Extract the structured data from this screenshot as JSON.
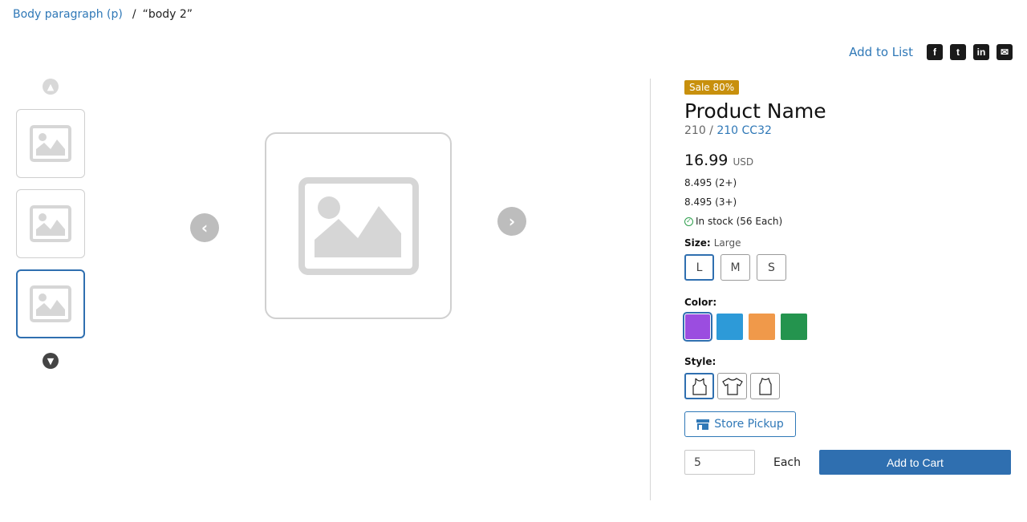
{
  "breadcrumb": {
    "link": "Body paragraph (p)",
    "separator": "/",
    "current": "“body 2”"
  },
  "share": {
    "add_to_list": "Add to List",
    "icons": [
      "facebook-icon",
      "twitter-icon",
      "linkedin-icon",
      "email-icon"
    ],
    "facebook_glyph": "f",
    "twitter_glyph": "t",
    "linkedin_glyph": "in",
    "email_glyph": "✉"
  },
  "gallery": {
    "thumbnails": [
      "image-placeholder",
      "image-placeholder",
      "image-placeholder"
    ],
    "active_thumbnail": 3,
    "prev_glyph": "‹",
    "next_glyph": "›",
    "up_glyph": "▲",
    "down_glyph": "▼"
  },
  "product": {
    "badge": "Sale 80%",
    "name": "Product Name",
    "sku_prefix": "210 / ",
    "sku_link": "210 CC32",
    "price": "16.99",
    "currency": "USD",
    "tier_prices": [
      "8.495 (2+)",
      "8.495 (3+)"
    ],
    "stock_text": "In stock (56 Each)",
    "stock_icon": "check-circle-icon"
  },
  "options": {
    "size_label": "Size:",
    "size_selected": "Large",
    "sizes": [
      "L",
      "M",
      "S"
    ],
    "color_label": "Color:",
    "colors": [
      "#9b4de0",
      "#2d9ad8",
      "#f0994a",
      "#24944e"
    ],
    "style_label": "Style:",
    "styles": [
      "tank-top-icon",
      "t-shirt-icon",
      "sleeveless-icon"
    ]
  },
  "actions": {
    "store_pickup": "Store Pickup",
    "quantity": "5",
    "unit": "Each",
    "add_to_cart": "Add to Cart"
  },
  "colors": {
    "accent": "#2f6fb0",
    "link": "#2f78b7",
    "badge": "#c8900d",
    "stock": "#2e9f4d"
  }
}
